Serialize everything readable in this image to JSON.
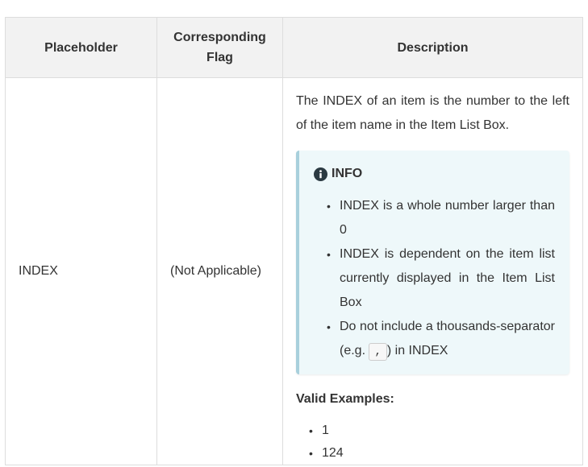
{
  "table": {
    "headers": {
      "placeholder": "Placeholder",
      "flag_line1": "Corresponding",
      "flag_line2": "Flag",
      "description": "Description"
    },
    "row": {
      "placeholder": "INDEX",
      "flag": "(Not Applicable)",
      "intro": "The INDEX of an item is the number to the left of the item name in the Item List Box.",
      "info": {
        "title": "INFO",
        "items": [
          "INDEX is a whole number larger than 0",
          "INDEX is dependent on the item list currently displayed in the Item List Box"
        ],
        "item3_before": "Do not include a thousands-separator (e.g. ",
        "item3_code": ",",
        "item3_after": ") in INDEX"
      },
      "valid_title": "Valid Examples:",
      "examples": [
        "1",
        "124"
      ]
    }
  },
  "colors": {
    "header_bg": "#f2f2f2",
    "info_bg": "#eef8fa",
    "info_border": "#a8d0dc",
    "border": "#dddddd"
  },
  "icons": {
    "info": "info-circle-icon"
  }
}
